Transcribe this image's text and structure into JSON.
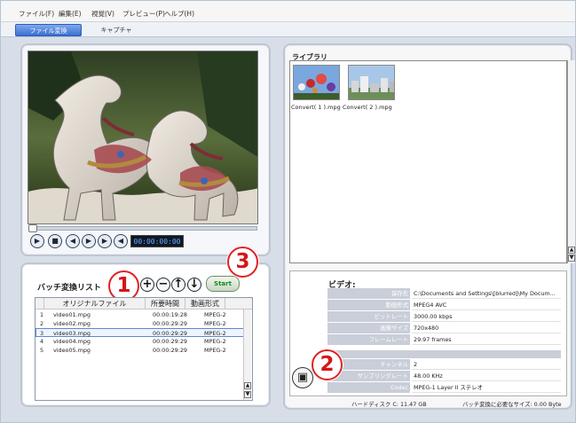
{
  "menu": [
    "ファイル(F)",
    "編集(E)",
    "視覚(V)",
    "プレビュー(P)",
    "ヘルプ(H)"
  ],
  "tabs": [
    "ファイル変換",
    "キャプチャ"
  ],
  "player": {
    "time": "00:00:00:00",
    "progress": 0
  },
  "batch": {
    "title": "バッチ変換リスト",
    "columns": [
      "オリジナルファイル",
      "所要時間",
      "動画形式"
    ],
    "rows": [
      {
        "no": "1",
        "name": "video01.mpg",
        "duration": "00:00:19:28",
        "format": "MPEG-2"
      },
      {
        "no": "2",
        "name": "video02.mpg",
        "duration": "00:00:29:29",
        "format": "MPEG-2"
      },
      {
        "no": "3",
        "name": "video03.mpg",
        "duration": "00:00:29:29",
        "format": "MPEG-2"
      },
      {
        "no": "4",
        "name": "video04.mpg",
        "duration": "00:00:29:29",
        "format": "MPEG-2"
      },
      {
        "no": "5",
        "name": "video05.mpg",
        "duration": "00:00:29:29",
        "format": "MPEG-2"
      }
    ],
    "start_label": "Start",
    "button_icons": [
      "plus-icon",
      "minus-icon",
      "arrow-up-icon",
      "arrow-down-icon"
    ]
  },
  "library": {
    "title": "ライブラリ",
    "items": [
      "Convert( 1 ).mpg",
      "Convert( 2 ).mpg"
    ]
  },
  "info": {
    "title": "ビデオ:",
    "labels": [
      "保存先",
      "動画形式",
      "ビットレート",
      "画像サイズ",
      "フレームレート",
      "チャンネル",
      "サンプリングレート",
      "Codec"
    ],
    "values": [
      "C:\\Documents and Settings\\[blurred]\\My Docum...",
      "MPEG4 AVC",
      "3000.00 kbps",
      "720x480",
      "29.97 frames",
      "2",
      "48.00 KHz",
      "MPEG-1 Layer II ステレオ"
    ]
  },
  "status": {
    "disk": "ハードディスク C: 11.47 GB",
    "required": "バッチ変換に必要なサイズ: 0.00 Byte"
  },
  "callouts": [
    "1",
    "2",
    "3"
  ]
}
